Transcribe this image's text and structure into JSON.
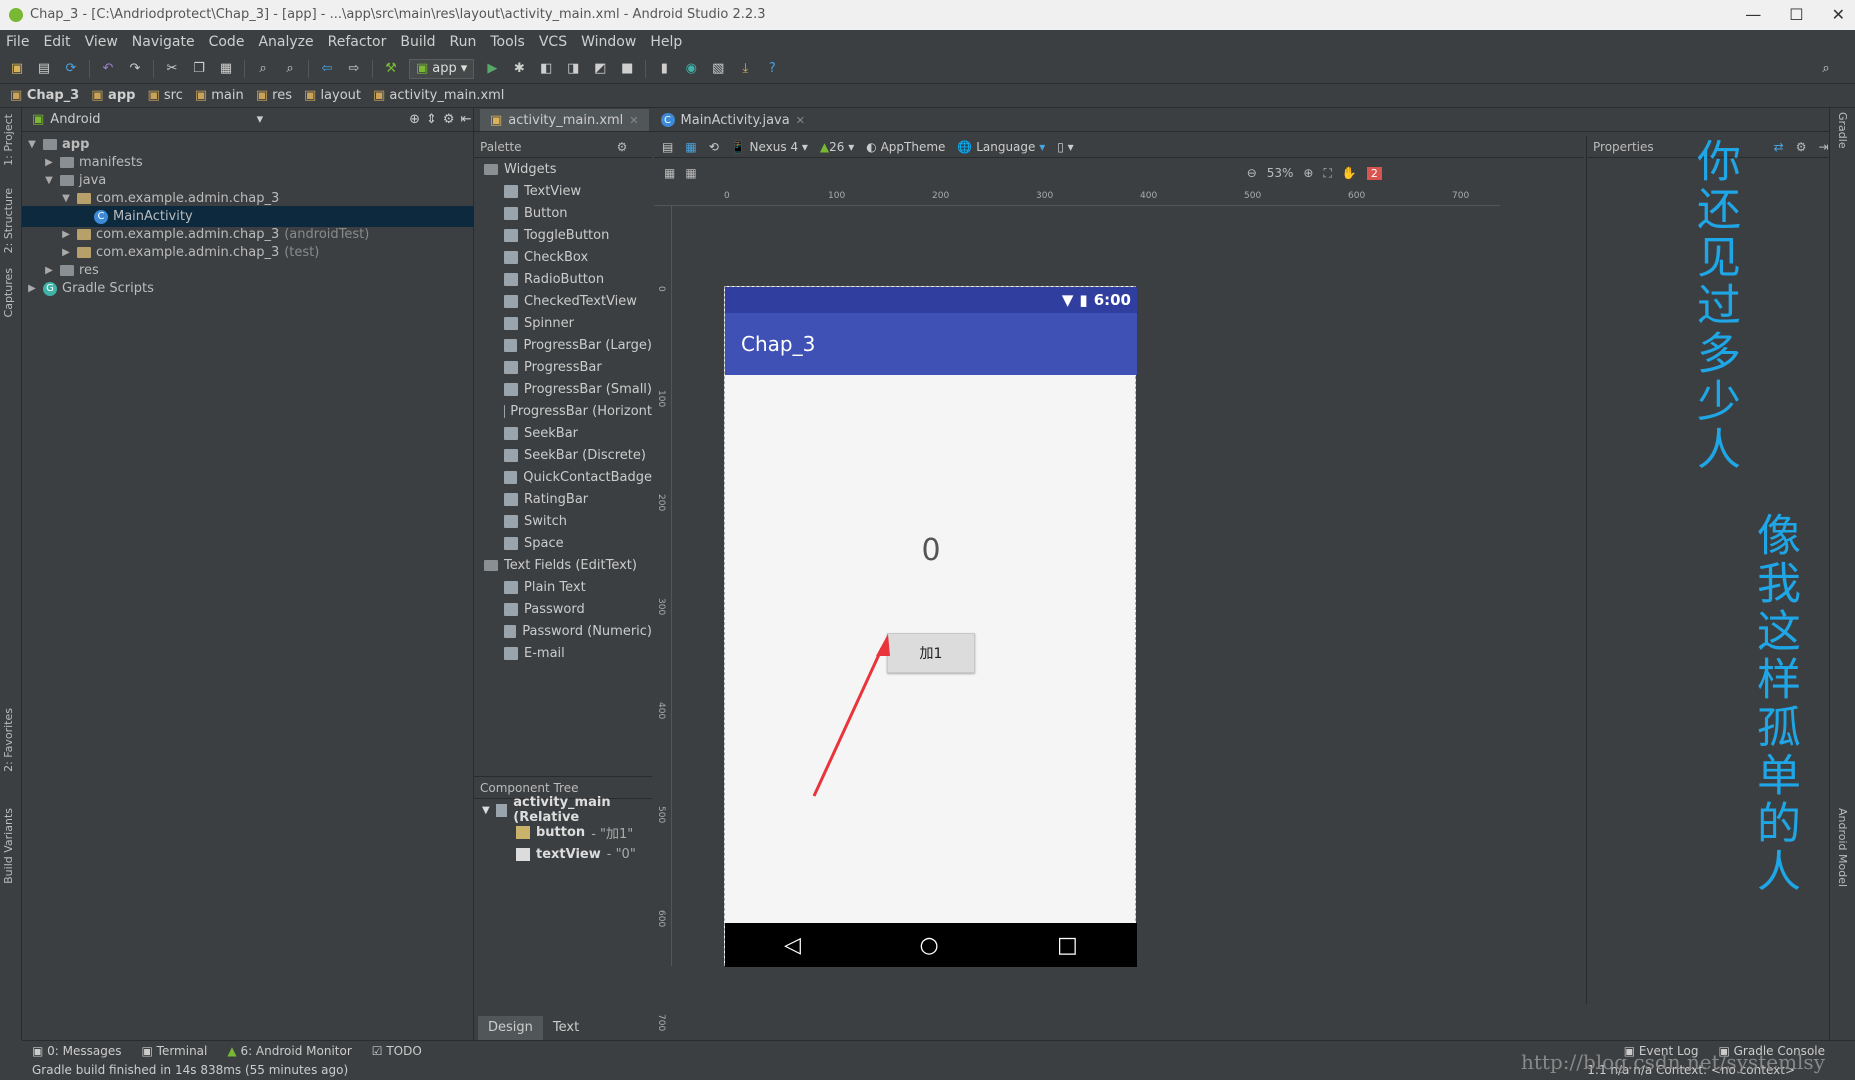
{
  "window": {
    "title": "Chap_3 - [C:\\Andriodprotect\\Chap_3] - [app] - ...\\app\\src\\main\\res\\layout\\activity_main.xml - Android Studio 2.2.3"
  },
  "menu": [
    "File",
    "Edit",
    "View",
    "Navigate",
    "Code",
    "Analyze",
    "Refactor",
    "Build",
    "Run",
    "Tools",
    "VCS",
    "Window",
    "Help"
  ],
  "toolbar": {
    "run_config": "app"
  },
  "breadcrumbs": [
    "Chap_3",
    "app",
    "src",
    "main",
    "res",
    "layout",
    "activity_main.xml"
  ],
  "left_tabs": [
    "1: Project",
    "2: Structure",
    "Captures",
    "2: Favorites",
    "Build Variants"
  ],
  "project": {
    "view_mode": "Android",
    "tree": [
      {
        "label": "app",
        "depth": 0,
        "kind": "folder",
        "expanded": true
      },
      {
        "label": "manifests",
        "depth": 1,
        "kind": "folder",
        "expanded": false
      },
      {
        "label": "java",
        "depth": 1,
        "kind": "folder",
        "expanded": true
      },
      {
        "label": "com.example.admin.chap_3",
        "depth": 2,
        "kind": "pkg",
        "expanded": true
      },
      {
        "label": "MainActivity",
        "depth": 3,
        "kind": "class",
        "selected": true
      },
      {
        "label": "com.example.admin.chap_3",
        "suffix": "(androidTest)",
        "depth": 2,
        "kind": "pkg",
        "expanded": false
      },
      {
        "label": "com.example.admin.chap_3",
        "suffix": "(test)",
        "depth": 2,
        "kind": "pkg",
        "expanded": false
      },
      {
        "label": "res",
        "depth": 1,
        "kind": "folder",
        "expanded": false
      },
      {
        "label": "Gradle Scripts",
        "depth": 0,
        "kind": "gradle",
        "expanded": false
      }
    ]
  },
  "editor_tabs": [
    {
      "label": "activity_main.xml",
      "active": true
    },
    {
      "label": "MainActivity.java",
      "active": false
    }
  ],
  "palette": {
    "title": "Palette",
    "groups": [
      {
        "name": "Widgets",
        "items": [
          "TextView",
          "Button",
          "ToggleButton",
          "CheckBox",
          "RadioButton",
          "CheckedTextView",
          "Spinner",
          "ProgressBar (Large)",
          "ProgressBar",
          "ProgressBar (Small)",
          "ProgressBar (Horizont",
          "SeekBar",
          "SeekBar (Discrete)",
          "QuickContactBadge",
          "RatingBar",
          "Switch",
          "Space"
        ]
      },
      {
        "name": "Text Fields (EditText)",
        "items": [
          "Plain Text",
          "Password",
          "Password (Numeric)",
          "E-mail"
        ]
      }
    ]
  },
  "component_tree": {
    "title": "Component Tree",
    "root": "activity_main (Relative",
    "children": [
      {
        "name": "button",
        "detail": "- \"加1\""
      },
      {
        "name": "textView",
        "detail": "- \"0\""
      }
    ]
  },
  "design_bar": {
    "device": "Nexus 4",
    "api": "26",
    "theme": "AppTheme",
    "language": "Language",
    "zoom": "53%",
    "warnings": "2"
  },
  "ruler": {
    "h": [
      "0",
      "100",
      "200",
      "300",
      "400",
      "500",
      "600",
      "700"
    ],
    "v": [
      "0",
      "100",
      "200",
      "300",
      "400",
      "500",
      "600",
      "700"
    ]
  },
  "preview": {
    "time": "6:00",
    "app_title": "Chap_3",
    "counter": "0",
    "button_label": "加1"
  },
  "properties": {
    "title": "Properties"
  },
  "overlay_text": {
    "col1": "你还见过多少人",
    "col2": "像我这样孤单的人"
  },
  "design_tabs": [
    {
      "label": "Design",
      "active": true
    },
    {
      "label": "Text",
      "active": false
    }
  ],
  "right_tabs": [
    "Gradle",
    "Android Model"
  ],
  "bottom_tools": [
    "0: Messages",
    "Terminal",
    "6: Android Monitor",
    "TODO",
    "Event Log",
    "Gradle Console"
  ],
  "status": {
    "message": "Gradle build finished in 14s 838ms (55 minutes ago)",
    "info": "1:1   n/a   n/a   Context: <no context>"
  },
  "watermark": "http://blog.csdn.net/systemlsy",
  "colors": {
    "accent": "#3f51b5",
    "status": "#303f9f",
    "overlay": "#1ea6e6",
    "selection": "#0d293e"
  }
}
